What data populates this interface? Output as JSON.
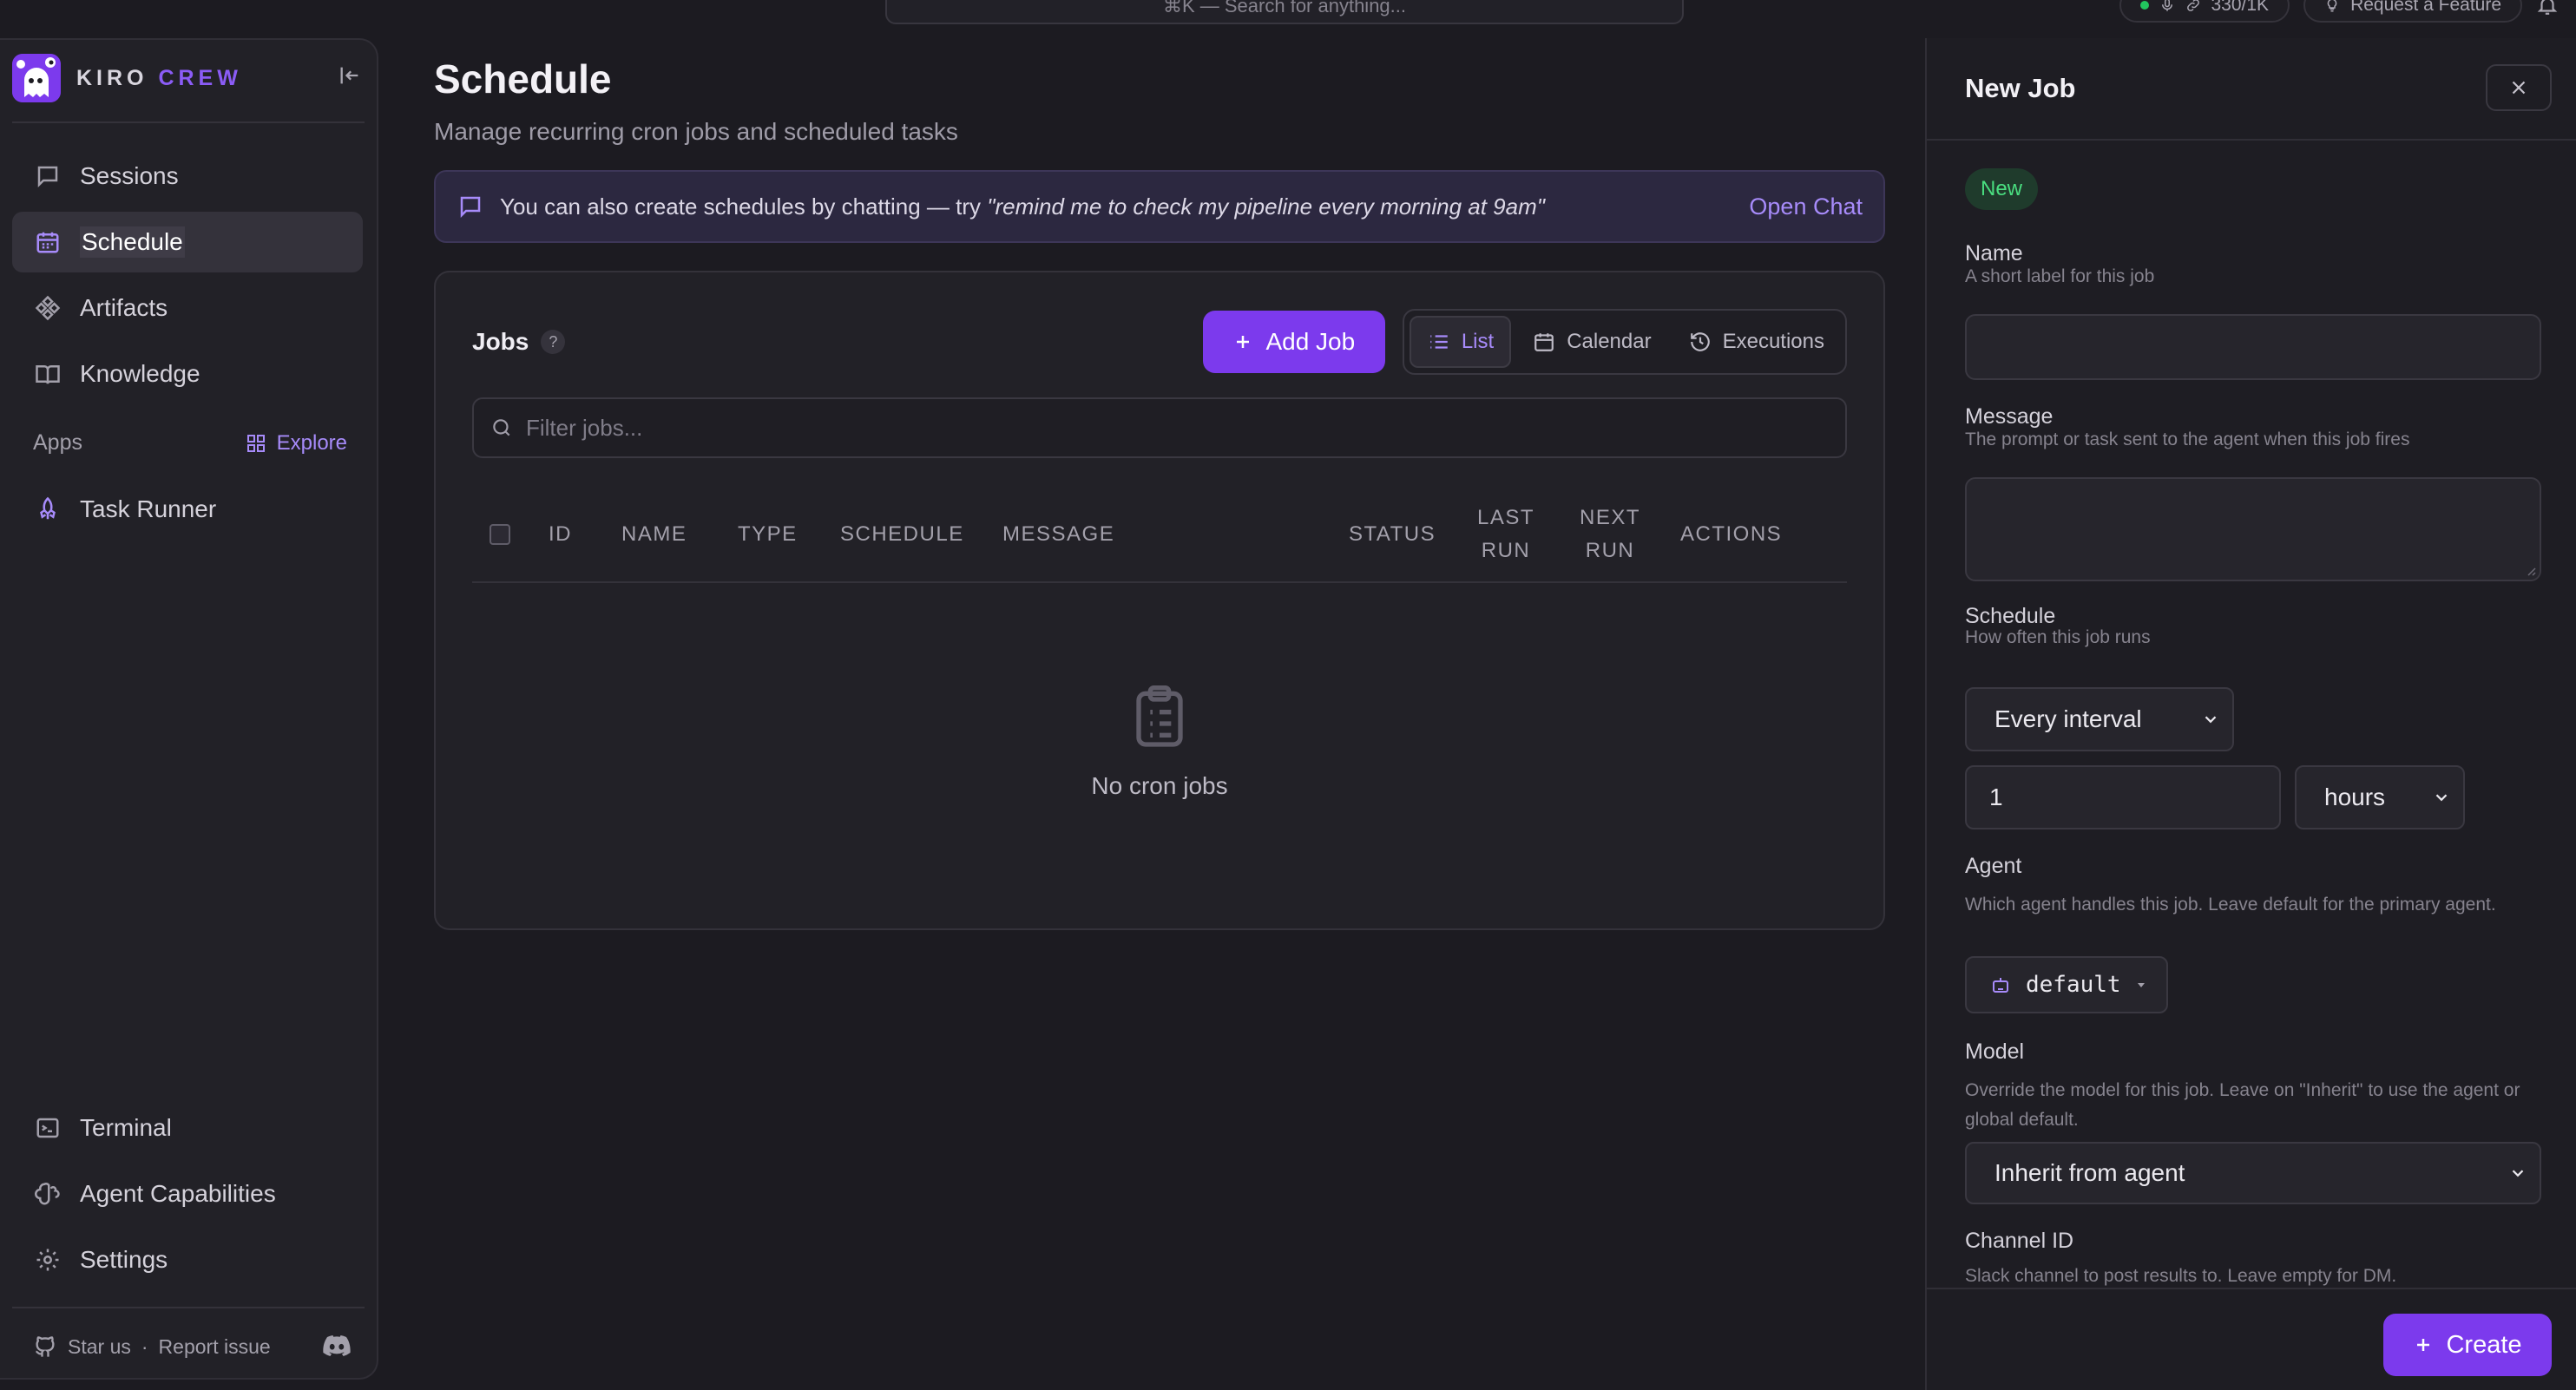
{
  "topbar": {
    "search_placeholder": "⌘K — Search for anything...",
    "usage": "330/1K",
    "request_feature": "Request a Feature"
  },
  "brand": {
    "word1": "KIRO",
    "word2": "CREW"
  },
  "sidebar": {
    "items": [
      {
        "label": "Sessions",
        "icon": "chat-bubble-icon"
      },
      {
        "label": "Schedule",
        "icon": "calendar-icon",
        "active": true
      },
      {
        "label": "Artifacts",
        "icon": "artifacts-icon"
      },
      {
        "label": "Knowledge",
        "icon": "book-icon"
      }
    ],
    "apps_label": "Apps",
    "explore_label": "Explore",
    "apps": [
      {
        "label": "Task Runner",
        "icon": "rocket-icon"
      }
    ],
    "bottom_items": [
      {
        "label": "Terminal",
        "icon": "terminal-icon"
      },
      {
        "label": "Agent Capabilities",
        "icon": "brain-icon"
      },
      {
        "label": "Settings",
        "icon": "gear-icon"
      }
    ],
    "footer": {
      "star": "Star us",
      "sep": "·",
      "report": "Report issue"
    }
  },
  "main": {
    "title": "Schedule",
    "subtitle": "Manage recurring cron jobs and scheduled tasks",
    "banner": {
      "text": "You can also create schedules by chatting — try ",
      "quote": "\"remind me to check my pipeline every morning at 9am\"",
      "action": "Open Chat"
    },
    "jobs": {
      "title": "Jobs",
      "help": "?",
      "add_label": "Add Job",
      "views": [
        "List",
        "Calendar",
        "Executions"
      ],
      "active_view": "List",
      "filter_placeholder": "Filter jobs...",
      "columns": [
        "ID",
        "NAME",
        "TYPE",
        "SCHEDULE",
        "MESSAGE",
        "STATUS",
        "LAST RUN",
        "NEXT RUN",
        "ACTIONS"
      ],
      "empty_text": "No cron jobs"
    }
  },
  "panel": {
    "title": "New Job",
    "status": "New",
    "name": {
      "label": "Name",
      "help": "A short label for this job",
      "value": ""
    },
    "message": {
      "label": "Message",
      "help": "The prompt or task sent to the agent when this job fires",
      "value": ""
    },
    "schedule": {
      "label": "Schedule",
      "help": "How often this job runs",
      "mode": "Every interval",
      "interval_value": "1",
      "interval_unit": "hours"
    },
    "agent": {
      "label": "Agent",
      "help": "Which agent handles this job. Leave default for the primary agent.",
      "value": "default"
    },
    "model": {
      "label": "Model",
      "help": "Override the model for this job. Leave on \"Inherit\" to use the agent or global default.",
      "value": "Inherit from agent"
    },
    "channel": {
      "label": "Channel ID",
      "help": "Slack channel to post results to. Leave empty for DM."
    },
    "create_label": "Create"
  },
  "colors": {
    "accent": "#7c3aed",
    "accent_text": "#a78bfa",
    "status_new": "#4ade80"
  }
}
